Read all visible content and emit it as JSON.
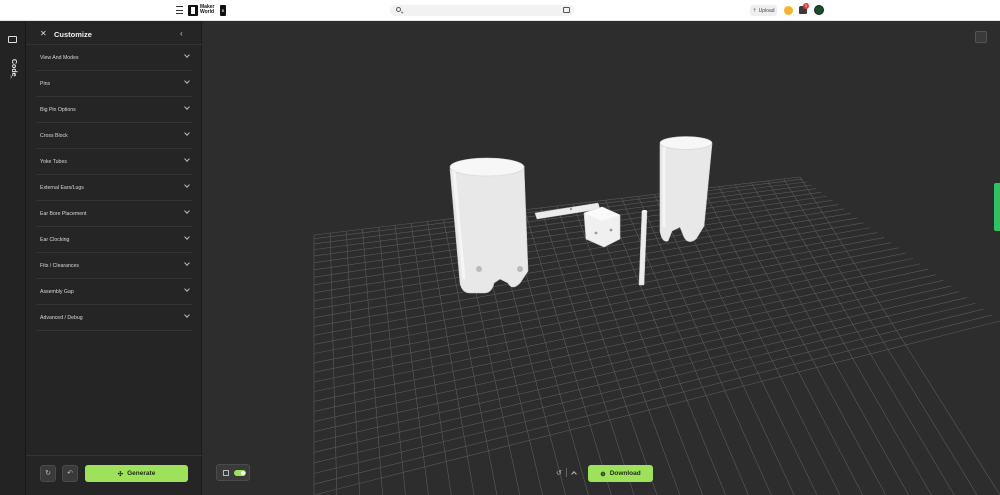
{
  "topbar": {
    "logo_text": "Maker World",
    "logo_badge": "B",
    "search_placeholder": "",
    "upload_label": "Upload",
    "notification_count": "1"
  },
  "rail": {
    "code_label": "Code"
  },
  "panel": {
    "title": "Customize",
    "sections": [
      {
        "label": "View And Modes"
      },
      {
        "label": "Pins"
      },
      {
        "label": "Big Pin Options"
      },
      {
        "label": "Cross Block"
      },
      {
        "label": "Yoke Tubes"
      },
      {
        "label": "External Ears/Lugs"
      },
      {
        "label": "Ear Bore Placement"
      },
      {
        "label": "Ear Clocking"
      },
      {
        "label": "Fits / Clearances"
      },
      {
        "label": "Assembly Gap"
      },
      {
        "label": "Advanced / Debug"
      }
    ],
    "generate_label": "Generate"
  },
  "viewport": {
    "download_label": "Download",
    "grid_toggle_on": true
  },
  "colors": {
    "accent": "#9ee25c",
    "panel_bg": "#252525",
    "viewport_bg": "#2d2d2d",
    "side_tab": "#2ec260"
  },
  "icons": [
    "hamburger-icon",
    "search-icon",
    "image-search-icon",
    "upload-icon",
    "coin-icon",
    "bell-icon",
    "code-icon",
    "customize-icon",
    "collapse-icon",
    "chevron-down-icon",
    "refresh-icon",
    "undo-icon",
    "generate-icon",
    "layers-icon",
    "grid-icon",
    "history-icon",
    "chevron-up-icon",
    "download-icon"
  ]
}
